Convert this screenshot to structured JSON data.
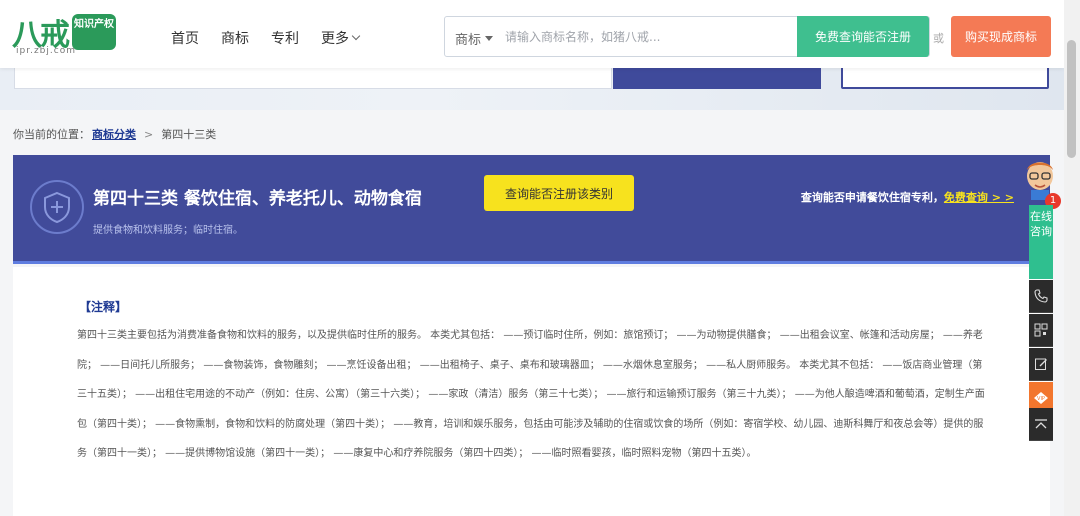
{
  "header": {
    "logo_text": "八戒",
    "logo_badge": "知识产权",
    "logo_sub": "ipr.zbj.com",
    "nav": [
      "首页",
      "商标",
      "专利"
    ],
    "nav_more": "更多",
    "search_type": "商标",
    "search_placeholder": "请输入商标名称，如猪八戒...",
    "search_button": "免费查询能否注册",
    "or_text": "或",
    "buy_button": "购买现成商标"
  },
  "breadcrumb": {
    "prefix": "你当前的位置：",
    "link": "商标分类",
    "separator": ">",
    "current": "第四十三类"
  },
  "class_banner": {
    "title": "第四十三类 餐饮住宿、养老托儿、动物食宿",
    "subtitle": "提供食物和饮料服务；临时住宿。",
    "check_button": "查询能否注册该类别",
    "promo_text": "查询能否申请餐饮住宿专利，",
    "promo_link": "免费查询 > >"
  },
  "note": {
    "title": "【注释】",
    "body": "第四十三类主要包括为消费准备食物和饮料的服务，以及提供临时住所的服务。 本类尤其包括： ——预订临时住所，例如：旅馆预订； ——为动物提供膳食； ——出租会议室、帐篷和活动房屋； ——养老院； ——日间托儿所服务； ——食物装饰，食物雕刻； ——烹饪设备出租； ——出租椅子、桌子、桌布和玻璃器皿； ——水烟休息室服务； ——私人厨师服务。 本类尤其不包括： ——饭店商业管理（第三十五类）； ——出租住宅用途的不动产（例如：住房、公寓）（第三十六类）； ——家政（清洁）服务（第三十七类）； ——旅行和运输预订服务（第三十九类）； ——为他人酿造啤酒和葡萄酒，定制生产面包（第四十类）； ——食物熏制，食物和饮料的防腐处理（第四十类）； ——教育，培训和娱乐服务，包括由可能涉及辅助的住宿或饮食的场所（例如：寄宿学校、幼儿园、迪斯科舞厅和夜总会等）提供的服务（第四十一类）； ——提供博物馆设施（第四十一类）； ——康复中心和疗养院服务（第四十四类）； ——临时照看婴孩，临时照料宠物（第四十五类）。"
  },
  "float_bar": {
    "badge_count": "1",
    "online_label": "在线咨询"
  },
  "colors": {
    "brand_green": "#2b9a5a",
    "banner_blue": "#414b9a",
    "search_green": "#3fbf8f",
    "buy_orange": "#f47a55",
    "check_yellow": "#f7e21e"
  }
}
